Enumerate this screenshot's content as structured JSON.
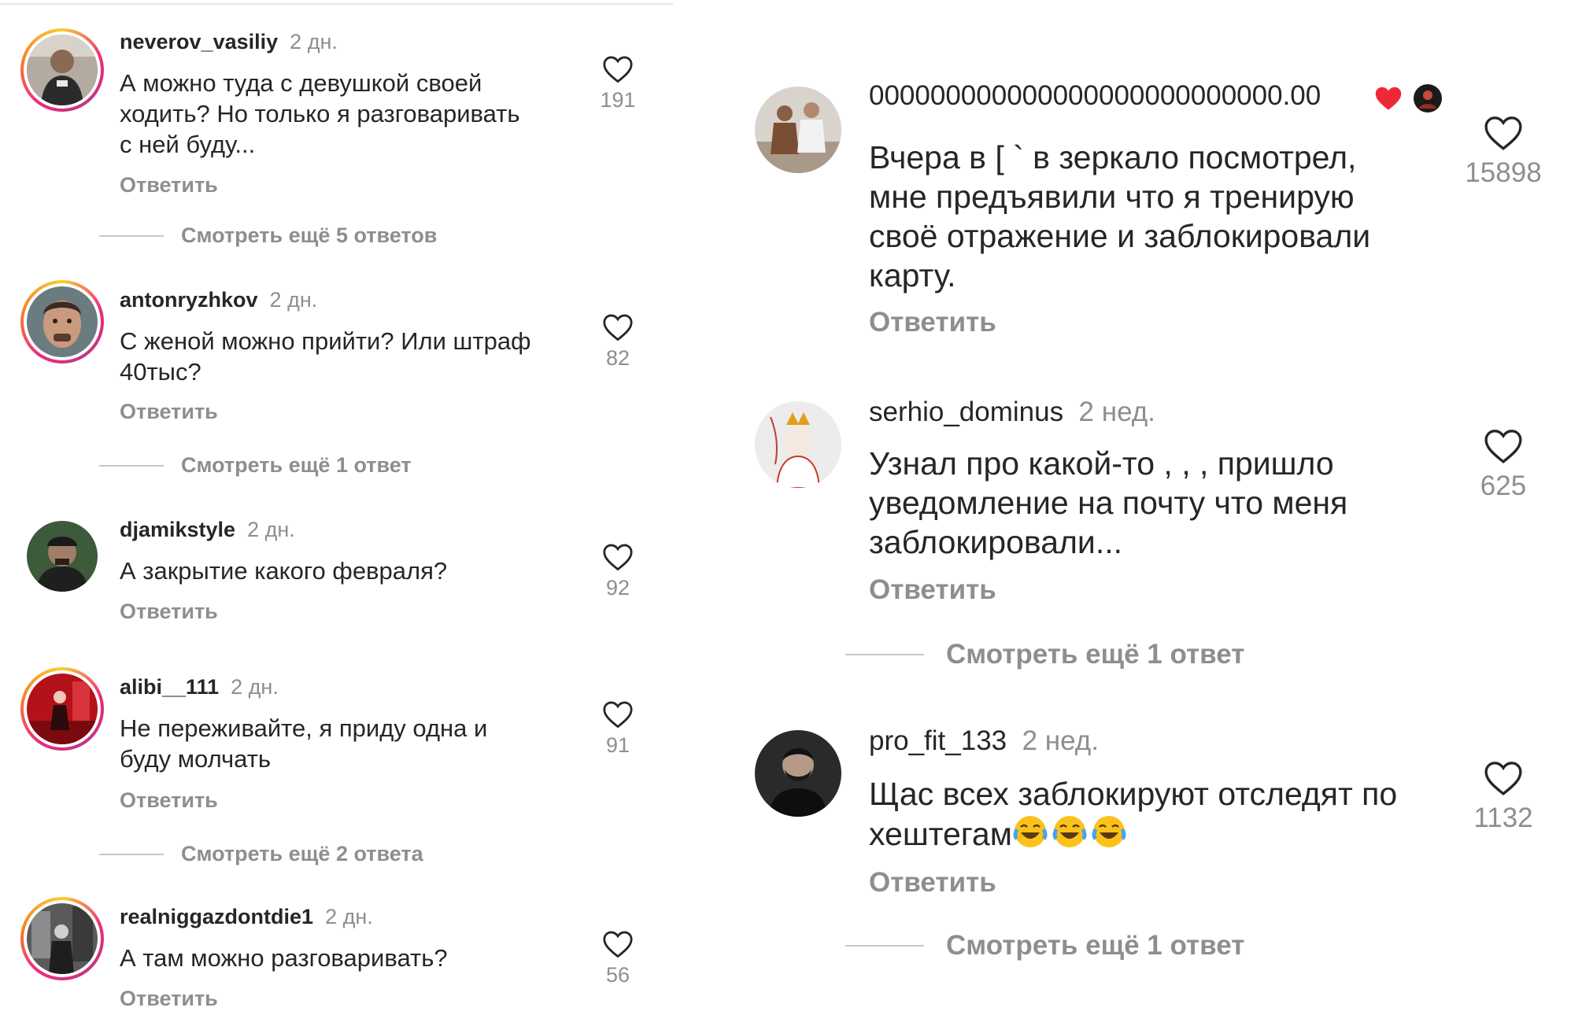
{
  "colors": {
    "text": "#262626",
    "muted": "#8e8e8e",
    "heart_red": "#ed2939",
    "story_ring": [
      "#f9ce34",
      "#ee2a7b",
      "#c13584",
      "#f58529"
    ]
  },
  "left": {
    "comments": [
      {
        "username": "neverov_vasiliy",
        "time": "2 дн.",
        "lines": [
          "А можно туда с девушкой своей",
          "ходить? Но только я разговаривать",
          "с ней буду..."
        ],
        "likes": "191",
        "reply": "Ответить",
        "more": "Смотреть ещё 5 ответов",
        "avatar_icon": "gym-selfie-avatar"
      },
      {
        "username": "antonryzhkov",
        "time": "2 дн.",
        "lines": [
          "С женой можно прийти? Или штраф",
          "40тыс?"
        ],
        "likes": "82",
        "reply": "Ответить",
        "more": "Смотреть ещё 1 ответ",
        "avatar_icon": "face-portrait-avatar"
      },
      {
        "username": "djamikstyle",
        "time": "2 дн.",
        "lines": [
          "А закрытие какого февраля?"
        ],
        "likes": "92",
        "reply": "Ответить",
        "avatar_icon": "dark-portrait-avatar"
      },
      {
        "username": "alibi__111",
        "time": "2 дн.",
        "lines": [
          "Не переживайте, я приду одна и",
          "буду молчать"
        ],
        "likes": "91",
        "reply": "Ответить",
        "more": "Смотреть ещё 2 ответа",
        "avatar_icon": "red-room-avatar"
      },
      {
        "username": "realniggazdontdie1",
        "time": "2 дн.",
        "lines": [
          "А там можно разговаривать?"
        ],
        "likes": "56",
        "reply": "Ответить",
        "avatar_icon": "bw-street-avatar"
      }
    ]
  },
  "right": {
    "comments": [
      {
        "username": "000000000000000000000000000.00",
        "lines": [
          "Вчера в [ ` в зеркало посмотрел,",
          "мне предъявили что я тренирую",
          "своё отражение и заблокировали",
          "карту."
        ],
        "likes": "15898",
        "reply": "Ответить",
        "badges": [
          "liked-by-author-heart-icon",
          "author-avatar-icon"
        ],
        "avatar_icon": "group-photo-avatar"
      },
      {
        "username": "serhio_dominus",
        "time": "2 нед.",
        "lines": [
          "Узнал про какой-то , , , пришло",
          "уведомление на почту что меня",
          "заблокировали..."
        ],
        "likes": "625",
        "reply": "Ответить",
        "more": "Смотреть ещё 1 ответ",
        "avatar_icon": "cartoon-king-avatar"
      },
      {
        "username": "pro_fit_133",
        "time": "2 нед.",
        "lines": [
          "Щас всех заблокируют отследят по",
          "хештегам"
        ],
        "emoji": "😂😂😂",
        "likes": "1132",
        "reply": "Ответить",
        "more": "Смотреть ещё 1 ответ",
        "avatar_icon": "bearded-man-avatar"
      }
    ]
  }
}
